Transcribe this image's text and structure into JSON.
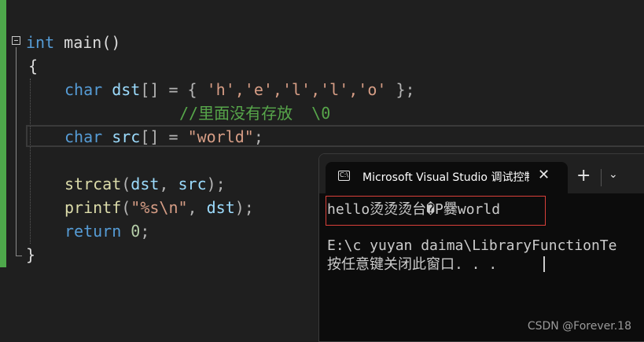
{
  "editor": {
    "lines": {
      "l1": {
        "kw": "int",
        "rest": " main()"
      },
      "l2": {
        "text": "{"
      },
      "l3": {
        "kw": "char",
        "id": " dst",
        "punct": "[] = { ",
        "chars": "'h','e','l','l','o'",
        "end": " };"
      },
      "l4": {
        "comment": "//里面没有存放  \\0"
      },
      "l5": {
        "kw": "char",
        "id": " src",
        "punct": "[] = ",
        "str": "\"world\"",
        "end": ";"
      },
      "l6": {
        "fn": "strcat",
        "open": "(",
        "a1": "dst",
        "sep": ", ",
        "a2": "src",
        "end": ");"
      },
      "l7": {
        "fn": "printf",
        "open": "(",
        "str": "\"%s\\n\"",
        "sep": ", ",
        "a1": "dst",
        "end": ");"
      },
      "l8": {
        "kw": "return",
        "num": " 0",
        "end": ";"
      },
      "l9": {
        "text": "}"
      }
    }
  },
  "terminal": {
    "tab_title": "Microsoft Visual Studio 调试控制台",
    "icon": "terminal-icon",
    "close": "✕",
    "new_tab": "+",
    "dropdown": "⌄",
    "output_line1": "hello烫烫烫台�P爨world",
    "output_line2": "E:\\c yuyan daima\\LibraryFunctionTe",
    "output_line3": "按任意键关闭此窗口. . ."
  },
  "watermark": "CSDN @Forever.18",
  "colors": {
    "keyword": "#569cd6",
    "string": "#d69d85",
    "comment": "#57a64a",
    "highlight_box": "#d9403a",
    "gutter_bar": "#4ea84b"
  }
}
